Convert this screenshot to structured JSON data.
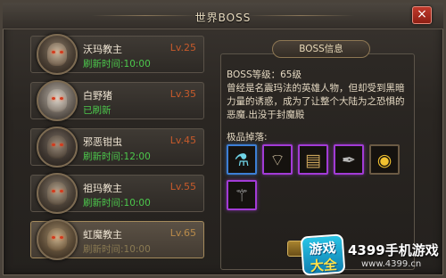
{
  "window": {
    "title": "世界BOSS",
    "close_icon": "×"
  },
  "boss_list": [
    {
      "name": "沃玛教主",
      "level": "Lv.25",
      "status": "刷新时间:10:00"
    },
    {
      "name": "白野猪",
      "level": "Lv.35",
      "status": "已刷新"
    },
    {
      "name": "邪恶钳虫",
      "level": "Lv.45",
      "status": "刷新时间:12:00"
    },
    {
      "name": "祖玛教主",
      "level": "Lv.55",
      "status": "刷新时间:10:00"
    },
    {
      "name": "虹魔教主",
      "level": "Lv.65",
      "status": "刷新时间:10:00"
    }
  ],
  "info": {
    "header": "BOSS信息",
    "level_line": "BOSS等级：65级",
    "description": "曾经是名震玛法的英雄人物，但却受到黑暗力量的诱惑，成为了让整个大陆为之恐惧的恶魔.出没于封魔殿",
    "drops_label": "极品掉落:",
    "drops": [
      {
        "icon": "potion-icon",
        "glyph": "⚗",
        "rarity": "blue"
      },
      {
        "icon": "fan-icon",
        "glyph": "⌔",
        "rarity": "purple"
      },
      {
        "icon": "scroll-icon",
        "glyph": "▤",
        "rarity": "purple"
      },
      {
        "icon": "feather-icon",
        "glyph": "✒",
        "rarity": "purple"
      },
      {
        "icon": "gold-icon",
        "glyph": "◉",
        "rarity": "brown"
      },
      {
        "icon": "staff-icon",
        "glyph": "⚚",
        "rarity": "purple"
      }
    ]
  },
  "watermark": {
    "logo_line1": "游戏",
    "logo_line2": "大全",
    "brand": "4399手机游戏",
    "url": "www.4399.cn"
  },
  "colors": {
    "level_red": "#c65a2b",
    "status_green": "#4cc84c",
    "rarity_blue": "#3d7fd6",
    "rarity_purple": "#a23bd6"
  }
}
